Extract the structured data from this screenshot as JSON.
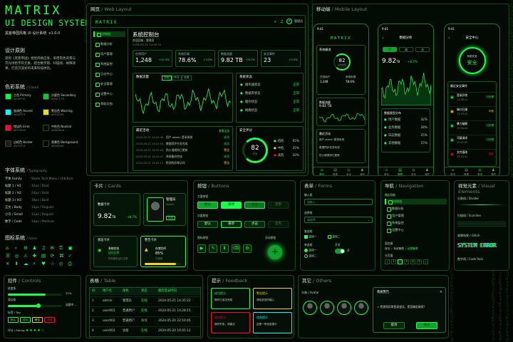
{
  "brand": {
    "title": "MATRIX",
    "subtitle": "UI DESIGN SYSTEM",
    "desc": "黑客帝国风格 UI 设计系统",
    "version": "v1.0.0"
  },
  "principles": {
    "title": "设计原则",
    "text": "受到《黑客帝国》视觉风格启发，采用黑色背景与荧光绿色字符元素，结合数字雨、扫描线、故障效果，打造沉浸式的未来科技体验。"
  },
  "colors": {
    "title": "色彩系统",
    "sub": "Colors",
    "items": [
      {
        "name": "主色 Primary",
        "hex": "#00FF41"
      },
      {
        "name": "次要色 Secondary",
        "hex": "#00CC33"
      },
      {
        "name": "强调色 Accent",
        "hex": "#00FFFF"
      },
      {
        "name": "警告色 Warning",
        "hex": "#FFD700"
      },
      {
        "name": "错误色 Error",
        "hex": "#FF003C"
      },
      {
        "name": "中性色 Neutral",
        "hex": "#0A0A0A"
      },
      {
        "name": "边框色 Border",
        "hex": "#1F1F1F"
      },
      {
        "name": "背景色 Background",
        "hex": "#000000"
      }
    ]
  },
  "typography": {
    "title": "字体系统",
    "sub": "Typography",
    "rows": [
      {
        "k": "字体 Family",
        "v": "Share Tech Mono / Orbitron"
      },
      {
        "k": "标题 1 / H1",
        "v": "32px / Bold"
      },
      {
        "k": "标题 2 / H2",
        "v": "24px / Bold"
      },
      {
        "k": "标题 3 / H3",
        "v": "18px / Bold"
      },
      {
        "k": "正文 / Body",
        "v": "14px / Regular"
      },
      {
        "k": "小号 / Small",
        "v": "12px / Regular"
      },
      {
        "k": "数字 / Code",
        "v": "14px / Medium"
      }
    ]
  },
  "icons": {
    "title": "图标系统",
    "sub": "Icons"
  },
  "web": {
    "title": "网页",
    "sub": "Web Layout",
    "logo": "MATRIX",
    "user": "管理员",
    "heading": "系统控制台",
    "welcome": "欢迎回来，管理员",
    "date": "2024-05-21 14:30:22",
    "sidebar": [
      "控制台",
      "数据分析",
      "用户管理",
      "系统监控",
      "日志中心",
      "安全管理",
      "设置中心",
      "帮助文档"
    ],
    "stats": [
      {
        "l": "在线用户",
        "v": "1,248",
        "d": "+12.5%"
      },
      {
        "l": "系统负载",
        "v": "78.6%",
        "d": "+3.2%"
      },
      {
        "l": "数据流量",
        "v": "9.82 TB",
        "d": "+8.7%"
      },
      {
        "l": "安全事件",
        "v": "23",
        "d": "+5.3%"
      }
    ],
    "flow": {
      "title": "数据流量",
      "tabs": [
        "实时",
        "今日",
        "本周"
      ]
    },
    "status": {
      "title": "系统状态",
      "items": [
        {
          "k": "服务器状态",
          "v": "正常"
        },
        {
          "k": "数据库状态",
          "v": "正常"
        },
        {
          "k": "缓存状态",
          "v": "正常"
        },
        {
          "k": "网络状态",
          "v": "正常"
        }
      ]
    },
    "activity": {
      "title": "最近活动",
      "more": "查看全部",
      "rows": [
        {
          "t": "2024-05-21 14:25:36",
          "e": "用户 admin 登录系统",
          "s": "成功"
        },
        {
          "t": "2024-05-21 14:22:18",
          "e": "数据同步任务完成",
          "s": "成功"
        },
        {
          "t": "2024-05-21 14:15:03",
          "e": "防火墙规则已更新",
          "s": "警告"
        },
        {
          "t": "2024-05-21 14:10:47",
          "e": "系统备份完成",
          "s": "成功"
        },
        {
          "t": "2024-05-21 14:05:12",
          "e": "检测到异常访问",
          "s": "警告"
        }
      ]
    },
    "security": {
      "title": "安全评分",
      "score": "82",
      "label": "安全",
      "items": [
        {
          "k": "低危",
          "v": "65%"
        },
        {
          "k": "中危",
          "v": "25%"
        },
        {
          "k": "高危",
          "v": "10%"
        }
      ]
    }
  },
  "mobile": {
    "title": "移动端",
    "sub": "Mobile Layout",
    "time": "9:41",
    "p1": {
      "logo": "MATRIX",
      "card": "系统概览",
      "score": "82",
      "scoreLabel": "系统健康",
      "a": "在线用户",
      "av": "1,248",
      "b": "系统负载",
      "bv": "78.6%",
      "c": "数据流量",
      "cv": "9.82 TB",
      "log": "最近活动",
      "logs": [
        "用户 admin 登录系统",
        "数据同步任务完成",
        "防火墙规则已更新"
      ]
    },
    "p2": {
      "title": "数据分析",
      "tabs": [
        "日",
        "周",
        "月"
      ],
      "value": "9.82",
      "unit": "TB",
      "delta": "+8.7%",
      "section": "数据类型分布",
      "rows": [
        {
          "k": "用户数据",
          "v": "32%"
        },
        {
          "k": "业务数据",
          "v": "28%"
        },
        {
          "k": "日志数据",
          "v": "25%"
        },
        {
          "k": "其他数据",
          "v": "15%"
        }
      ]
    },
    "p3": {
      "title": "安全中心",
      "status": "系统安全",
      "state": "安全",
      "section": "最近安全事件",
      "rows": [
        {
          "k": "登录异常",
          "t": "13:38:12",
          "s": "已处理"
        },
        {
          "k": "端口扫描",
          "t": "13:15:22",
          "s": "中危"
        },
        {
          "k": "暴力破解",
          "t": "12:58:44",
          "s": "已处理"
        },
        {
          "k": "可疑请求",
          "t": "12:32:09",
          "s": "已处理"
        },
        {
          "k": "文件篡改",
          "t": "12:10:33",
          "s": "高危"
        }
      ]
    },
    "tabs": [
      "首页",
      "数据",
      "安全",
      "我的"
    ]
  },
  "cards": {
    "title": "卡片",
    "sub": "Cards",
    "data": {
      "title": "数据卡片",
      "value": "9.82",
      "unit": "TB",
      "delta": "+8.7%"
    },
    "profile": {
      "name": "管理员",
      "role": "Admin",
      "status": "在线"
    },
    "state": {
      "title": "状态卡片",
      "a": "系统状态",
      "b": "运行正常",
      "c": "所有服务运行正常"
    },
    "warn": {
      "title": "警告卡片",
      "a": "存储空间",
      "b": "85%",
      "c": "已使用"
    }
  },
  "buttons": {
    "title": "按钮",
    "sub": "Buttons",
    "primary": "主要按钮",
    "secondary": "次要按钮",
    "icon": "图标按钮",
    "float": "浮动按钮",
    "labels": [
      "默认",
      "悬停",
      "点击",
      "禁用"
    ]
  },
  "forms": {
    "title": "表单",
    "sub": "Forms",
    "input": "输入框",
    "inputPh": "请输入...",
    "select": "选择框",
    "selectPh": "请选择",
    "check": "复选框",
    "radio": "单选框",
    "switch": "开关",
    "c1": "选项一",
    "c2": "选项二",
    "on": "开",
    "off": "关"
  },
  "nav": {
    "title": "导航",
    "sub": "Navigation",
    "side": "侧边导航",
    "items": [
      "控制台",
      "数据分析",
      "用户管理",
      "系统监控",
      "设置中心"
    ],
    "bc": "面包屑",
    "bcItems": [
      "首页",
      "/",
      "系统管理",
      "/",
      "权限管理"
    ],
    "pg": "分页器",
    "pages": [
      "1",
      "2",
      "3",
      "4",
      "5"
    ]
  },
  "visual": {
    "title": "视觉元素",
    "sub": "Visual Elements",
    "divider": "分割线 / Divider",
    "scan": "扫描线 / Scanline",
    "glitch": "故障效果 / Glitch",
    "glitchText": "SYSTEM ERROR",
    "rain": "数字雨 / Code Rain"
  },
  "controls": {
    "title": "控件",
    "sub": "Controls",
    "progress": "进度条",
    "pv": "70%",
    "slider": "滑动条",
    "loading": "加载中...",
    "tag": "标签 / Tag",
    "tags": [
      "默认",
      "成功",
      "警告",
      "错误"
    ],
    "rating": "评分 / Rating",
    "stars": "★★★★☆"
  },
  "table": {
    "title": "表格",
    "sub": "Table",
    "cols": [
      "ID",
      "用户名",
      "角色",
      "状态",
      "最后登录时间"
    ],
    "rows": [
      [
        "1",
        "admin",
        "管理员",
        "在线",
        "2024-05-21 14:35:22"
      ],
      [
        "2",
        "user001",
        "普通用户",
        "在线",
        "2024-05-21 14:28:15"
      ],
      [
        "3",
        "user002",
        "普通用户",
        "离线",
        "2024-05-20 22:10:45"
      ],
      [
        "4",
        "user003",
        "访客",
        "在线",
        "2024-05-20 16:45:12"
      ]
    ]
  },
  "feedback": {
    "title": "提示",
    "sub": "Feedback",
    "items": [
      {
        "t": "成功提示",
        "d": "操作已成功完成"
      },
      {
        "t": "警告提示",
        "d": "请检查您的输入"
      },
      {
        "t": "错误提示",
        "d": "操作失败，请重试"
      },
      {
        "t": "信息提示",
        "d": "这是一条信息提示"
      }
    ]
  },
  "others": {
    "title": "其它",
    "sub": "Others",
    "avatar": "头像 / Avatar",
    "modal": {
      "title": "系统警告",
      "text": "检测到异常登录尝试，是否确定继续？",
      "cancel": "取消",
      "ok": "确认"
    }
  }
}
